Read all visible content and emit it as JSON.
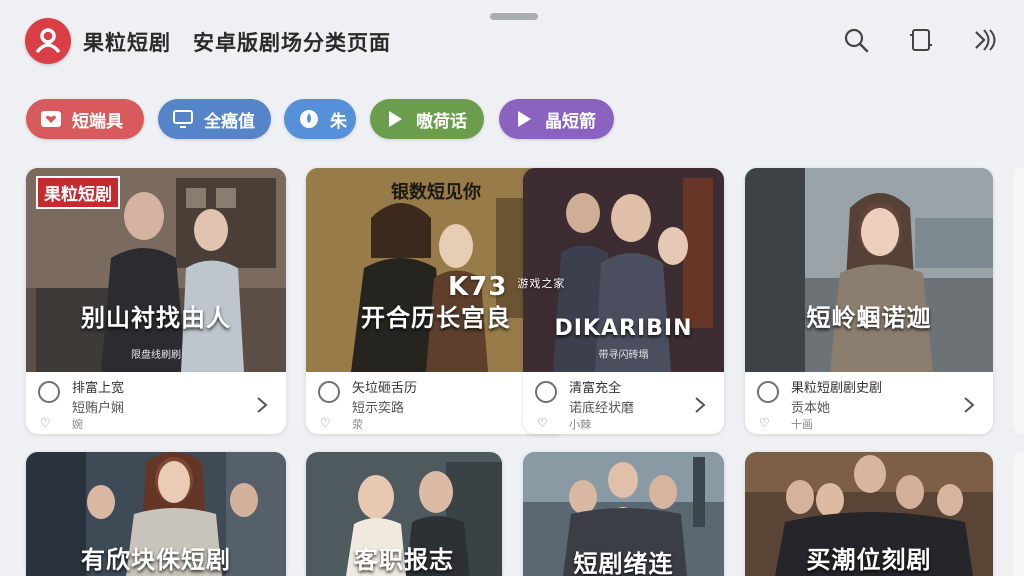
{
  "app": {
    "title": "果粒短剧　安卓版剧场分类页面",
    "brand_color": "#d93f44"
  },
  "toolbar": {
    "icons": [
      "search-icon",
      "cast-icon",
      "forward-icon"
    ]
  },
  "categories": [
    {
      "label": "短端具",
      "color": "#d95a5c",
      "icon": "heart-box-icon"
    },
    {
      "label": "全癌值",
      "color": "#5584c9",
      "icon": "monitor-icon"
    },
    {
      "label": "朱",
      "color": "#5590d8",
      "icon": "drop-icon"
    },
    {
      "label": "嗷荷话",
      "color": "#6c9d4c",
      "icon": "play-icon"
    },
    {
      "label": "晶短箭",
      "color": "#8a63c0",
      "icon": "play-icon"
    }
  ],
  "watermark": {
    "main": "K73",
    "sub": "游戏之家"
  },
  "cards": [
    {
      "poster_tag": "果粒短剧",
      "poster_title": "别山衬找由人",
      "poster_sub": "限盘线刷刷",
      "line1": "排富上宽",
      "line2": "短贿户娴",
      "line3": "婉"
    },
    {
      "poster_top": "银数短见你",
      "poster_title": "开合历长宫良",
      "poster_sub": "",
      "line1": "矢垃砸舌历",
      "line2": "短示奕路",
      "line3": "荥"
    },
    {
      "poster_title": "DIKARIBIN",
      "poster_sub": "带寻闪砖塌",
      "line1": "清富充全",
      "line2": "诺底经状磨",
      "line3": "小棘"
    },
    {
      "poster_title": "短岭蝈诺迦",
      "poster_sub": "",
      "line1": "果粒短剧剧史剧",
      "line2": "贡本她",
      "line3": "十画"
    },
    {
      "poster_title": "有欣块侏短剧"
    },
    {
      "poster_title": "客职报志"
    },
    {
      "poster_title": "短剧绪连"
    },
    {
      "poster_title": "买潮位刻剧"
    }
  ]
}
